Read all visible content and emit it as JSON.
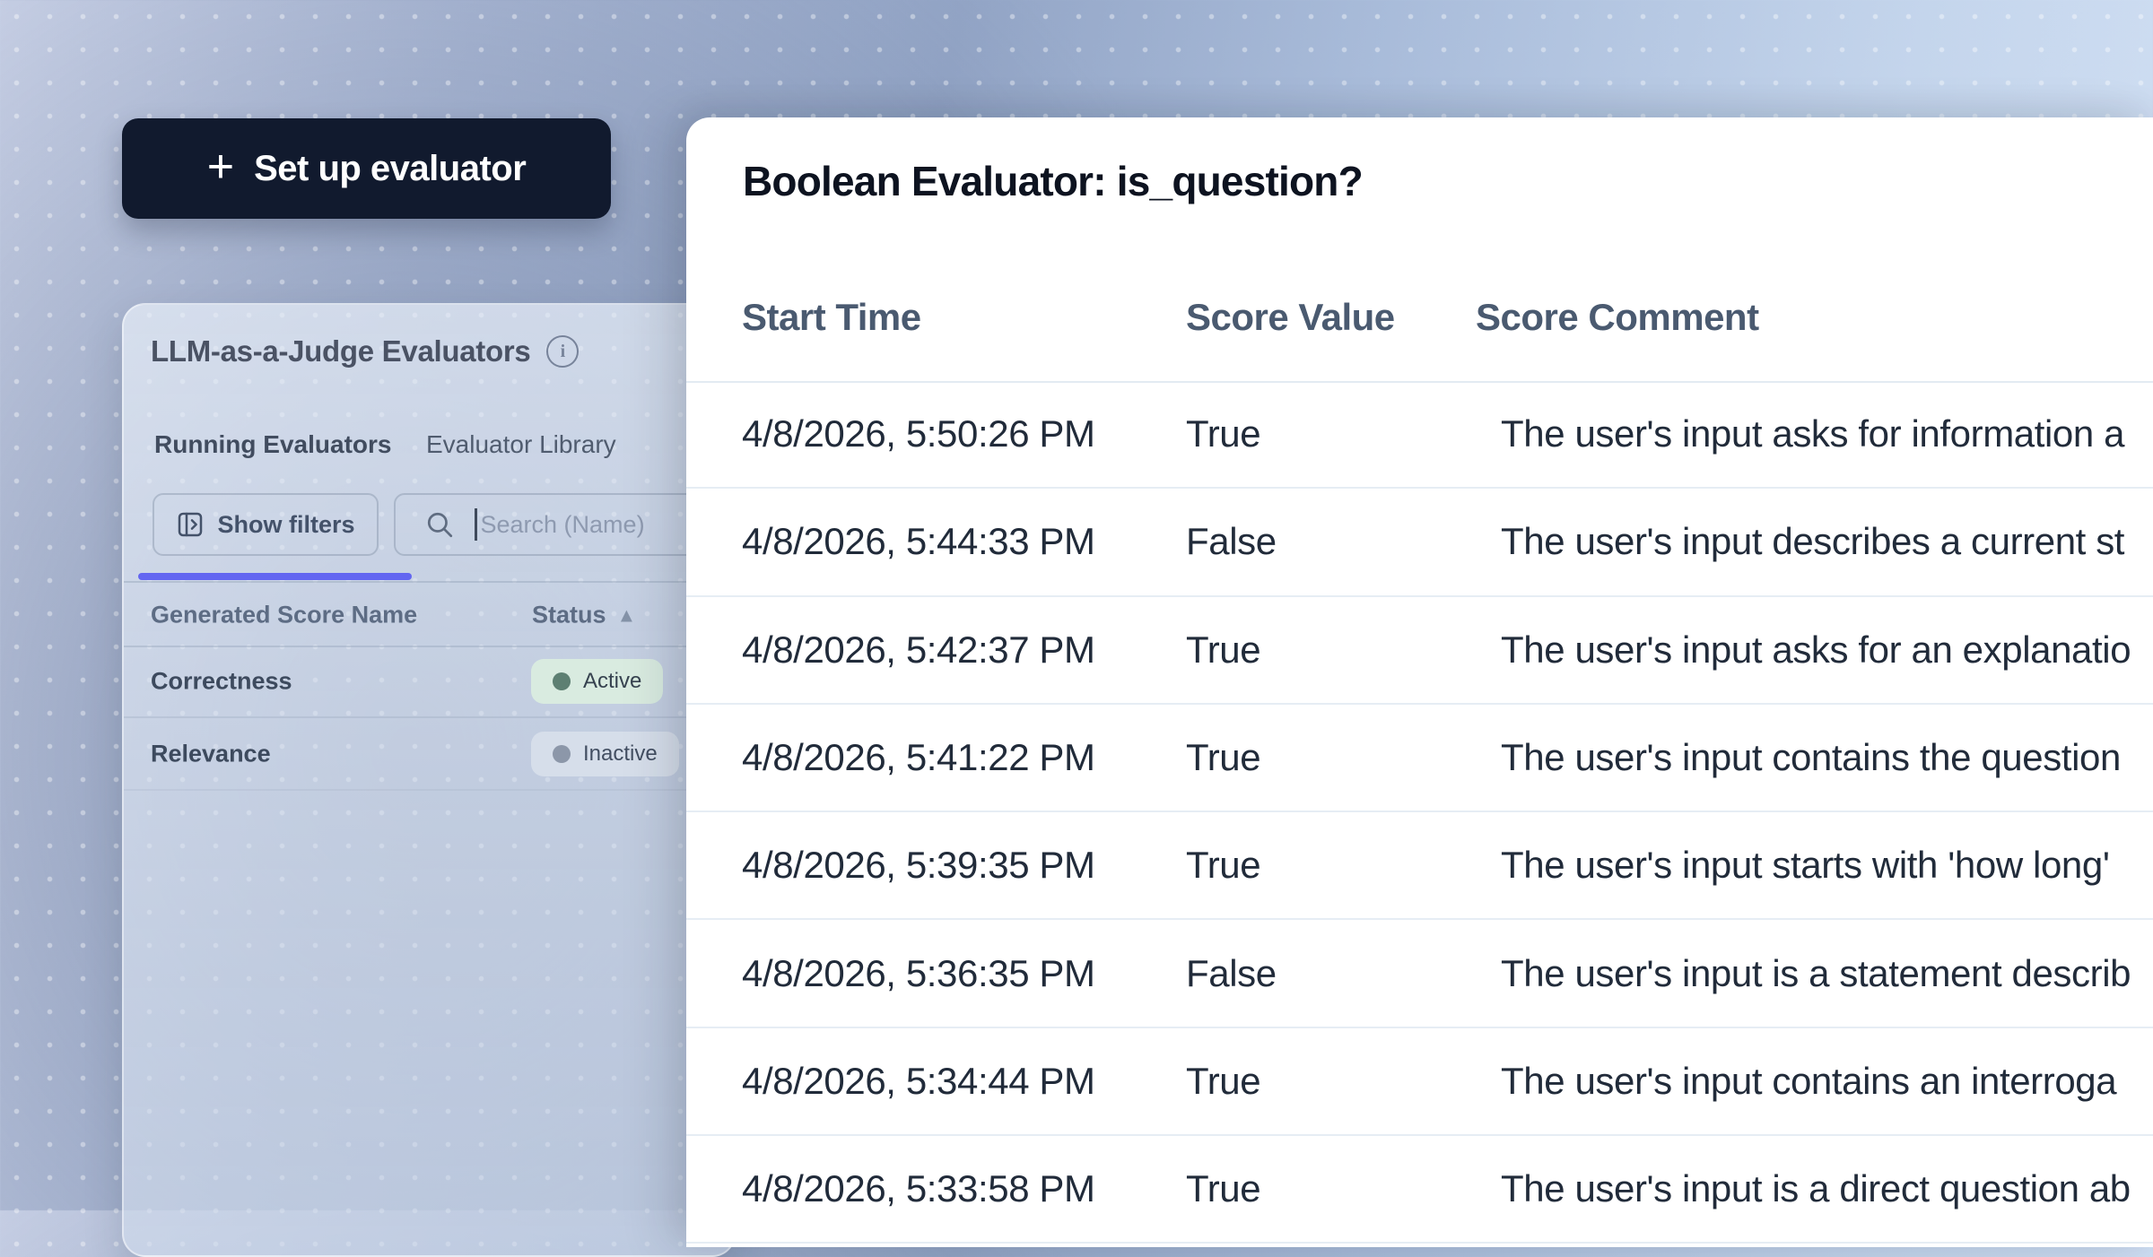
{
  "colors": {
    "accent_indigo": "#6366f1",
    "button_bg": "#111a2e",
    "active_badge_bg": "#d9ebe0",
    "active_dot": "#5d7f72",
    "inactive_badge_bg": "#d6deea",
    "inactive_dot": "#8c97a9",
    "panel_bg": "#ffffff",
    "row_divider": "#e6edf4"
  },
  "setup_button": {
    "plus": "+",
    "label": "Set up evaluator"
  },
  "evaluators_panel": {
    "title": "LLM-as-a-Judge Evaluators",
    "tabs": [
      {
        "label": "Running Evaluators",
        "active": true
      },
      {
        "label": "Evaluator Library",
        "active": false
      }
    ],
    "show_filters_label": "Show filters",
    "search_placeholder": "Search (Name)",
    "table": {
      "columns": {
        "name": "Generated Score Name",
        "status": "Status"
      },
      "sort_icon": "▲",
      "rows": [
        {
          "name": "Correctness",
          "status": "Active"
        },
        {
          "name": "Relevance",
          "status": "Inactive"
        }
      ]
    }
  },
  "detail_panel": {
    "title": "Boolean Evaluator: is_question?",
    "table": {
      "columns": {
        "start_time": "Start Time",
        "score_value": "Score Value",
        "score_comment": "Score Comment"
      },
      "rows": [
        {
          "start_time": "4/8/2026, 5:50:26 PM",
          "score_value": "True",
          "score_comment": "The user's input asks for information a"
        },
        {
          "start_time": "4/8/2026, 5:44:33 PM",
          "score_value": "False",
          "score_comment": "The user's input describes a current st"
        },
        {
          "start_time": "4/8/2026, 5:42:37 PM",
          "score_value": "True",
          "score_comment": "The user's input asks for an explanatio"
        },
        {
          "start_time": "4/8/2026, 5:41:22 PM",
          "score_value": "True",
          "score_comment": "The user's input contains the question"
        },
        {
          "start_time": "4/8/2026, 5:39:35 PM",
          "score_value": "True",
          "score_comment": "The user's input starts with 'how long'"
        },
        {
          "start_time": "4/8/2026, 5:36:35 PM",
          "score_value": "False",
          "score_comment": "The user's input is a statement describ"
        },
        {
          "start_time": "4/8/2026, 5:34:44 PM",
          "score_value": "True",
          "score_comment": "The user's input contains an interroga"
        },
        {
          "start_time": "4/8/2026, 5:33:58 PM",
          "score_value": "True",
          "score_comment": "The user's input is a direct question ab"
        }
      ]
    }
  }
}
